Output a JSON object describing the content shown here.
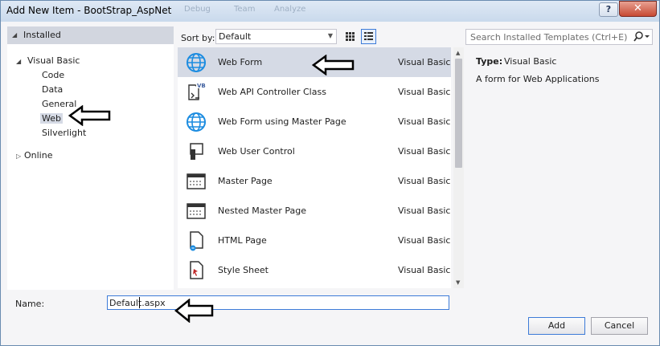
{
  "window": {
    "title": "Add New Item - BootStrap_AspNet",
    "behind_title_fragments": [
      "Debug",
      "Team",
      "Analyze"
    ],
    "help_glyph": "?",
    "close_glyph": "✕"
  },
  "left_pane": {
    "installed_label": "Installed",
    "tree": {
      "root_label": "Visual Basic",
      "children": [
        "Code",
        "Data",
        "General",
        "Web",
        "Silverlight"
      ],
      "selected": "Web",
      "online_label": "Online"
    }
  },
  "toolbar": {
    "sort_label": "Sort by:",
    "sort_value": "Default",
    "view_modes": [
      "small-icons-view",
      "list-view"
    ],
    "active_view": "list-view"
  },
  "templates": [
    {
      "name": "Web Form",
      "language": "Visual Basic",
      "icon": "globe-icon",
      "selected": true
    },
    {
      "name": "Web API Controller Class",
      "language": "Visual Basic",
      "icon": "vb-class-icon",
      "selected": false
    },
    {
      "name": "Web Form using Master Page",
      "language": "Visual Basic",
      "icon": "globe-icon",
      "selected": false
    },
    {
      "name": "Web User Control",
      "language": "Visual Basic",
      "icon": "user-control-icon",
      "selected": false
    },
    {
      "name": "Master Page",
      "language": "Visual Basic",
      "icon": "master-page-icon",
      "selected": false
    },
    {
      "name": "Nested Master Page",
      "language": "Visual Basic",
      "icon": "master-page-icon",
      "selected": false
    },
    {
      "name": "HTML Page",
      "language": "Visual Basic",
      "icon": "html-page-icon",
      "selected": false
    },
    {
      "name": "Style Sheet",
      "language": "Visual Basic",
      "icon": "style-sheet-icon",
      "selected": false
    }
  ],
  "search": {
    "placeholder": "Search Installed Templates (Ctrl+E)",
    "icon": "search-icon"
  },
  "details": {
    "type_label": "Type:",
    "type_value": "Visual Basic",
    "description": "A form for Web Applications"
  },
  "name_field": {
    "label": "Name:",
    "value": "Default.aspx"
  },
  "buttons": {
    "add": "Add",
    "cancel": "Cancel"
  },
  "annotations": {
    "arrow_color": "#000000",
    "arrow_fill": "#ffffff"
  },
  "colors": {
    "accent": "#3d7bd8",
    "selected_row": "#d5dae5",
    "header_band": "#d2d6df",
    "globe_blue": "#1c8ce0"
  }
}
